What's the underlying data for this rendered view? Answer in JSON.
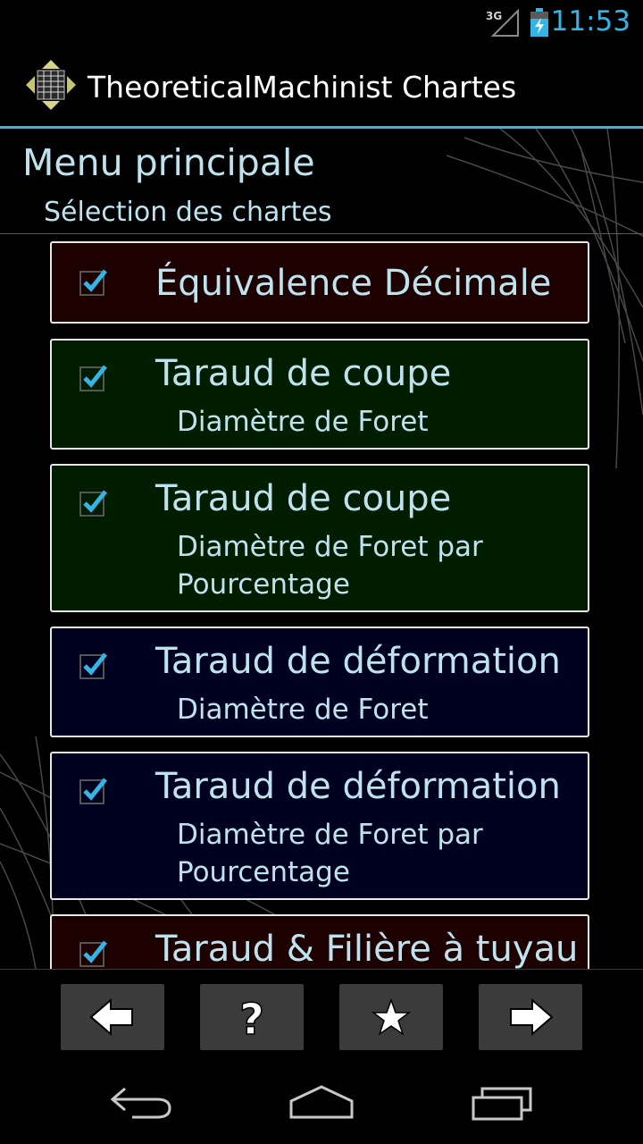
{
  "statusbar": {
    "network": "3G",
    "time": "11:53"
  },
  "actionbar": {
    "title": "TheoreticalMachinist Chartes",
    "icon": "app-logo-icon"
  },
  "menu": {
    "title": "Menu principale",
    "subtitle": "Sélection des chartes"
  },
  "charts": [
    {
      "title": "Équivalence Décimale",
      "subtitle": "",
      "color": "#1d0000",
      "checked": true
    },
    {
      "title": "Taraud de coupe",
      "subtitle": "Diamètre de Foret",
      "color": "#001d00",
      "checked": true
    },
    {
      "title": "Taraud de coupe",
      "subtitle": "Diamètre de Foret par Pourcentage",
      "color": "#001d00",
      "checked": true
    },
    {
      "title": "Taraud de déformation",
      "subtitle": "Diamètre de Foret",
      "color": "#00001f",
      "checked": true
    },
    {
      "title": "Taraud de déformation",
      "subtitle": "Diamètre de Foret par Pourcentage",
      "color": "#00001f",
      "checked": true
    },
    {
      "title": "Taraud & Filière à tuyau",
      "subtitle": "",
      "color": "#1d0000",
      "checked": true
    }
  ],
  "toolbar": {
    "buttons": [
      "back-arrow-icon",
      "help-question-icon",
      "favorite-star-icon",
      "forward-arrow-icon"
    ]
  },
  "navbar": {
    "buttons": [
      "back-icon",
      "home-icon",
      "recent-apps-icon"
    ]
  },
  "colors": {
    "accent": "#33b5e5",
    "text": "#bfe3ee"
  }
}
